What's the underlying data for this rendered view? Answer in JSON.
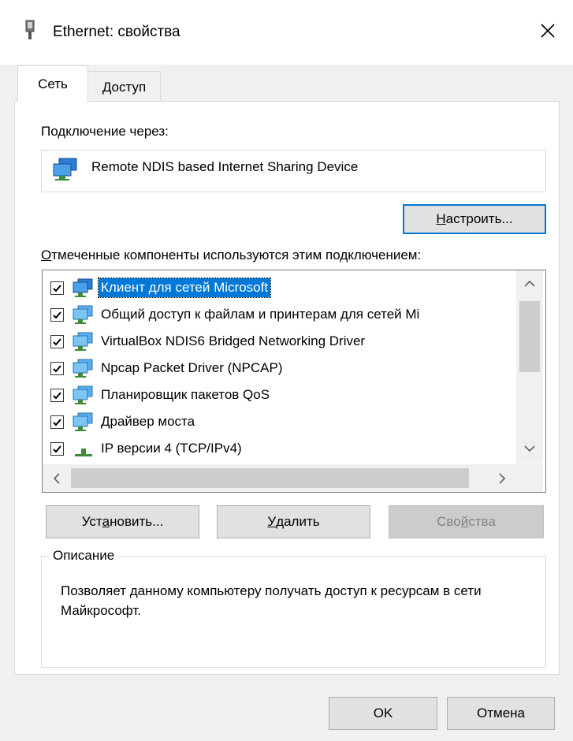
{
  "window": {
    "title": "Ethernet: свойства",
    "icon": "network-adapter-icon",
    "close_icon": "close-icon"
  },
  "tabs": [
    {
      "label": "Сеть",
      "active": true
    },
    {
      "label": "Доступ",
      "active": false
    }
  ],
  "connection": {
    "label": "Подключение через:",
    "device": "Remote NDIS based Internet Sharing Device",
    "configure_button": {
      "prefix": "",
      "accel": "Н",
      "rest": "астроить..."
    }
  },
  "components": {
    "label": {
      "accel": "О",
      "rest": "тмеченные компоненты используются этим подключением:"
    },
    "items": [
      {
        "label": "Клиент для сетей Microsoft",
        "checked": true,
        "selected": true,
        "icon": "network-client-icon"
      },
      {
        "label": "Общий доступ к файлам и принтерам для сетей Mi",
        "checked": true,
        "selected": false,
        "icon": "network-service-icon"
      },
      {
        "label": "VirtualBox NDIS6 Bridged Networking Driver",
        "checked": true,
        "selected": false,
        "icon": "network-service-icon"
      },
      {
        "label": "Npcap Packet Driver (NPCAP)",
        "checked": true,
        "selected": false,
        "icon": "network-service-icon"
      },
      {
        "label": "Планировщик пакетов QoS",
        "checked": true,
        "selected": false,
        "icon": "network-service-icon"
      },
      {
        "label": "Драйвер моста",
        "checked": true,
        "selected": false,
        "icon": "network-service-icon"
      },
      {
        "label": "IP версии 4 (TCP/IPv4)",
        "checked": true,
        "selected": false,
        "icon": "network-protocol-icon"
      }
    ]
  },
  "buttons": {
    "install": {
      "prefix": "Уст",
      "accel": "а",
      "rest": "новить..."
    },
    "remove": {
      "prefix": "",
      "accel": "У",
      "rest": "далить"
    },
    "properties": {
      "prefix": "Сво",
      "accel": "й",
      "rest": "ства"
    }
  },
  "description": {
    "legend": "Описание",
    "text": "Позволяет данному компьютеру получать доступ к ресурсам в сети Майкрософт."
  },
  "footer": {
    "ok": "OK",
    "cancel": "Отмена"
  },
  "colors": {
    "selection": "#0078d7",
    "default_button_border": "#0078d7"
  }
}
